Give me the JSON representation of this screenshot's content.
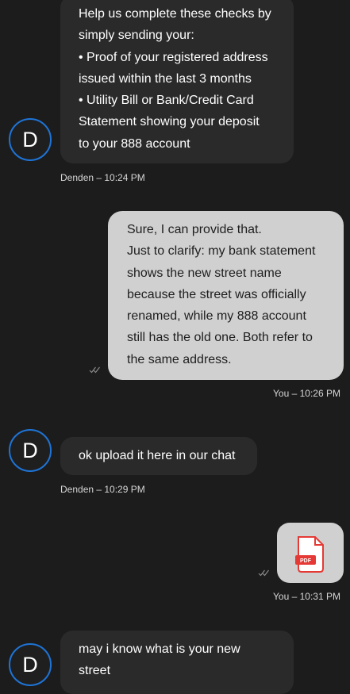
{
  "messages": [
    {
      "lines": [
        "Help us complete these checks by",
        "simply sending your:",
        "• Proof of your registered address",
        "issued within the last 3 months",
        "• Utility Bill or Bank/Credit Card",
        "Statement showing your deposit",
        "to your 888 account"
      ],
      "avatar": "D",
      "meta": "Denden – 10:24 PM"
    },
    {
      "lines": [
        "Sure, I can provide that.",
        "Just to clarify: my bank statement",
        "shows the new street name",
        "because the street was officially",
        "renamed, while my 888 account",
        "still has the old one. Both refer to",
        "the same address."
      ],
      "meta": "You – 10:26 PM"
    },
    {
      "lines": [
        "ok upload it here in our chat"
      ],
      "avatar": "D",
      "meta": "Denden – 10:29 PM"
    },
    {
      "attachment": {
        "badge": "PDF",
        "icon": "pdf-file-icon"
      },
      "meta": "You – 10:31 PM"
    },
    {
      "lines": [
        "may i know what is your new",
        "street"
      ],
      "avatar": "D"
    }
  ],
  "colors": {
    "background": "#1c1c1d",
    "incoming_bubble": "#2a2a2b",
    "outgoing_bubble": "#d0d0d0",
    "avatar_ring": "#1e74d6",
    "pdf_red": "#e53935"
  }
}
